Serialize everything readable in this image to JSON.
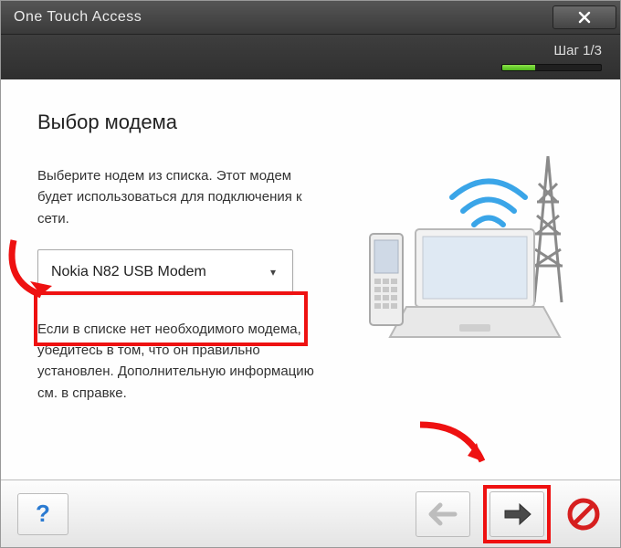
{
  "window": {
    "title": "One Touch Access"
  },
  "step": {
    "label": "Шаг 1/3",
    "progress_percent": 33
  },
  "main": {
    "heading": "Выбор модема",
    "intro": "Выберите нодем из списка. Этот модем будет использоваться для подключения к сети.",
    "help_text": "Если в списке нет необходимого модема, убедитесь в том, что он правильно установлен. Дополнительную информацию см. в справке.",
    "modem_dropdown": {
      "selected": "Nokia N82 USB Modem"
    }
  },
  "footer": {
    "help_label": "?",
    "back_label": "Назад",
    "next_label": "Далее",
    "cancel_label": "Отмена"
  },
  "annotations": {
    "highlight_dropdown": true,
    "highlight_next": true
  },
  "colors": {
    "accent_red": "#e11",
    "progress_green": "#5cc626"
  }
}
